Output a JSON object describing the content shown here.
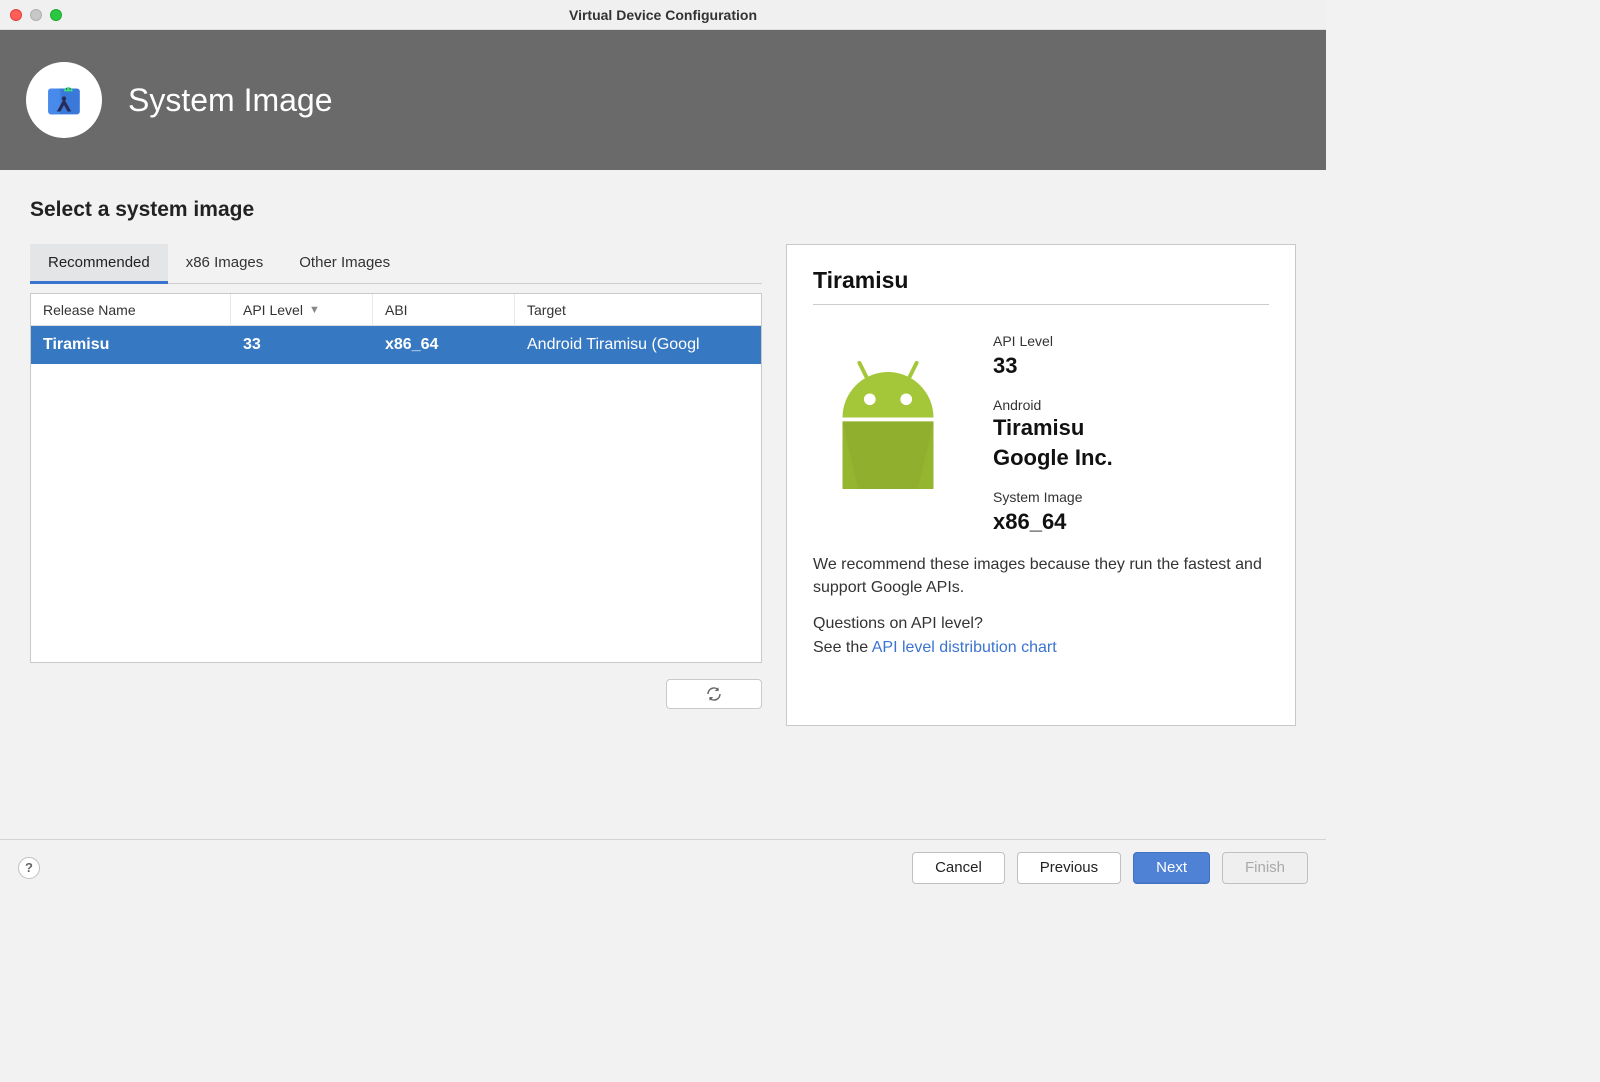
{
  "window": {
    "title": "Virtual Device Configuration"
  },
  "header": {
    "title": "System Image"
  },
  "main": {
    "section_title": "Select a system image",
    "tabs": [
      {
        "label": "Recommended"
      },
      {
        "label": "x86 Images"
      },
      {
        "label": "Other Images"
      }
    ],
    "columns": {
      "release": "Release Name",
      "api": "API Level",
      "abi": "ABI",
      "target": "Target"
    },
    "rows": [
      {
        "release": "Tiramisu",
        "api": "33",
        "abi": "x86_64",
        "target": "Android Tiramisu (Googl"
      }
    ]
  },
  "detail": {
    "title": "Tiramisu",
    "api_label": "API Level",
    "api_value": "33",
    "android_label": "Android",
    "android_name": "Tiramisu",
    "vendor": "Google Inc.",
    "sysimg_label": "System Image",
    "sysimg_value": "x86_64",
    "blurb": "We recommend these images because they run the fastest and support Google APIs.",
    "question": "Questions on API level?",
    "see_prefix": "See the ",
    "link_text": "API level distribution chart"
  },
  "footer": {
    "cancel": "Cancel",
    "previous": "Previous",
    "next": "Next",
    "finish": "Finish"
  }
}
